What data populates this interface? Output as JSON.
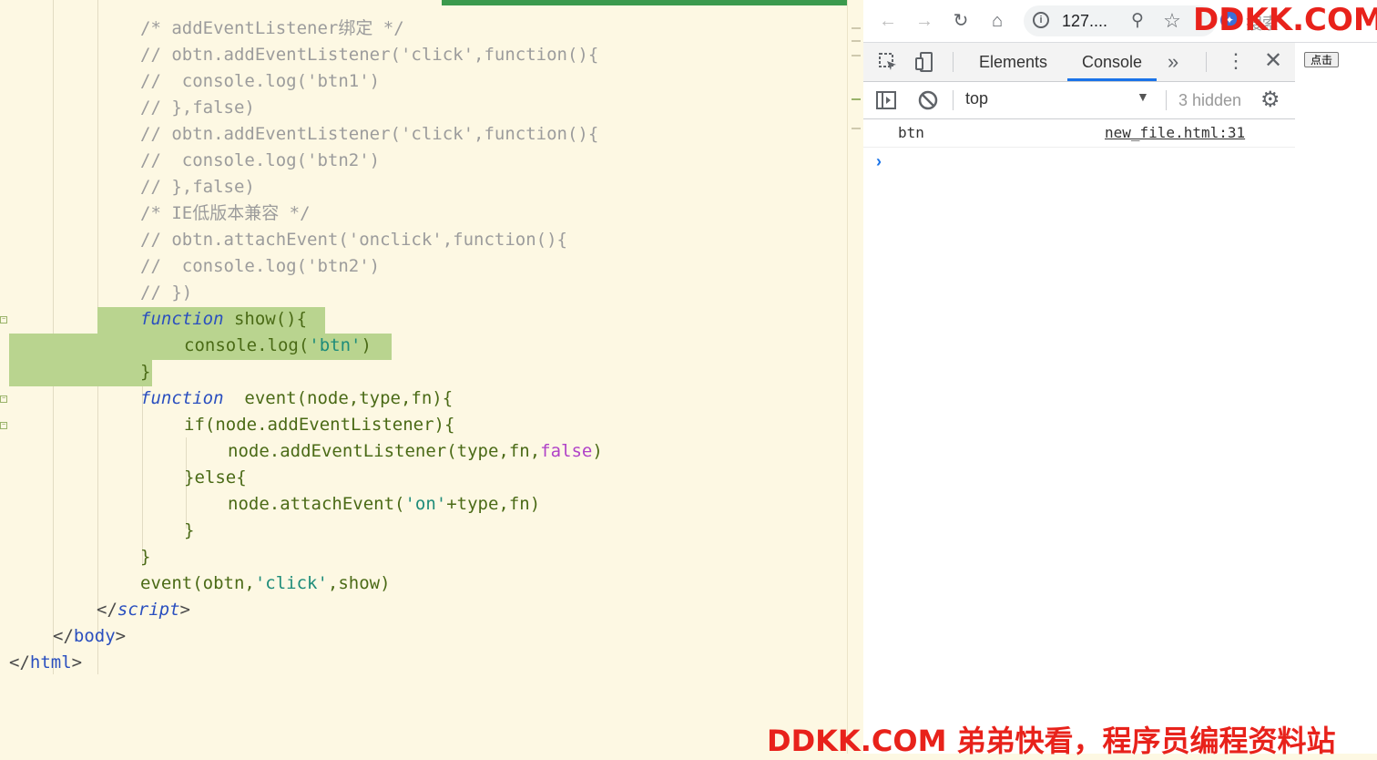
{
  "editor": {
    "lines": [
      {
        "comment": "/* addEventListener绑定 */"
      },
      {
        "comment": "// obtn.addEventListener('click',function(){"
      },
      {
        "comment": "//  console.log('btn1')"
      },
      {
        "comment": "// },false)"
      },
      {
        "comment": "// obtn.addEventListener('click',function(){"
      },
      {
        "comment": "//  console.log('btn2')"
      },
      {
        "comment": "// },false)"
      },
      {
        "comment": "/* IE低版本兼容 */"
      },
      {
        "comment": "// obtn.attachEvent('onclick',function(){"
      },
      {
        "comment": "//  console.log('btn2')"
      },
      {
        "comment": "// })"
      }
    ],
    "code": {
      "kw_function": "function",
      "show_decl": " show(){",
      "console_log": "console.log(",
      "str_btn": "'btn'",
      "close_paren": ")",
      "close_brace": "}",
      "event_decl": "  event(node,type,fn){",
      "if_line": "if(node.addEventListener){",
      "add_listener": "node.addEventListener(type,fn,",
      "bool_false": "false",
      "else_line": "}else{",
      "attach_event": "node.attachEvent(",
      "str_on": "'on'",
      "attach_rest": "+type,fn)",
      "event_call_a": "event(obtn,",
      "str_click": "'click'",
      "event_call_b": ",show)",
      "script_close_a": "</",
      "script_close_b": "script",
      "script_close_c": ">",
      "body_close_b": "body",
      "html_close_b": "html"
    }
  },
  "browser": {
    "nav": {
      "back_icon": "arrow-left",
      "forward_icon": "arrow-right",
      "reload_icon": "reload",
      "home_icon": "home",
      "url": "127....",
      "search_placeholder": "搜索"
    },
    "devtools": {
      "tabs": [
        "Elements",
        "Console"
      ],
      "active_tab": "Console",
      "context": "top",
      "hidden_count": "3 hidden",
      "log": {
        "message": "btn",
        "source": "new_file.html:31"
      },
      "prompt": "›"
    },
    "page": {
      "button_label": "点击"
    }
  },
  "watermark": {
    "top": "DDKK.COM",
    "bottom": "DDKK.COM 弟弟快看，程序员编程资料站"
  },
  "colors": {
    "editor_bg": "#fdf8e3",
    "highlight": "#b9d48f",
    "accent_blue": "#1a73e8",
    "watermark_red": "#e8221b"
  }
}
